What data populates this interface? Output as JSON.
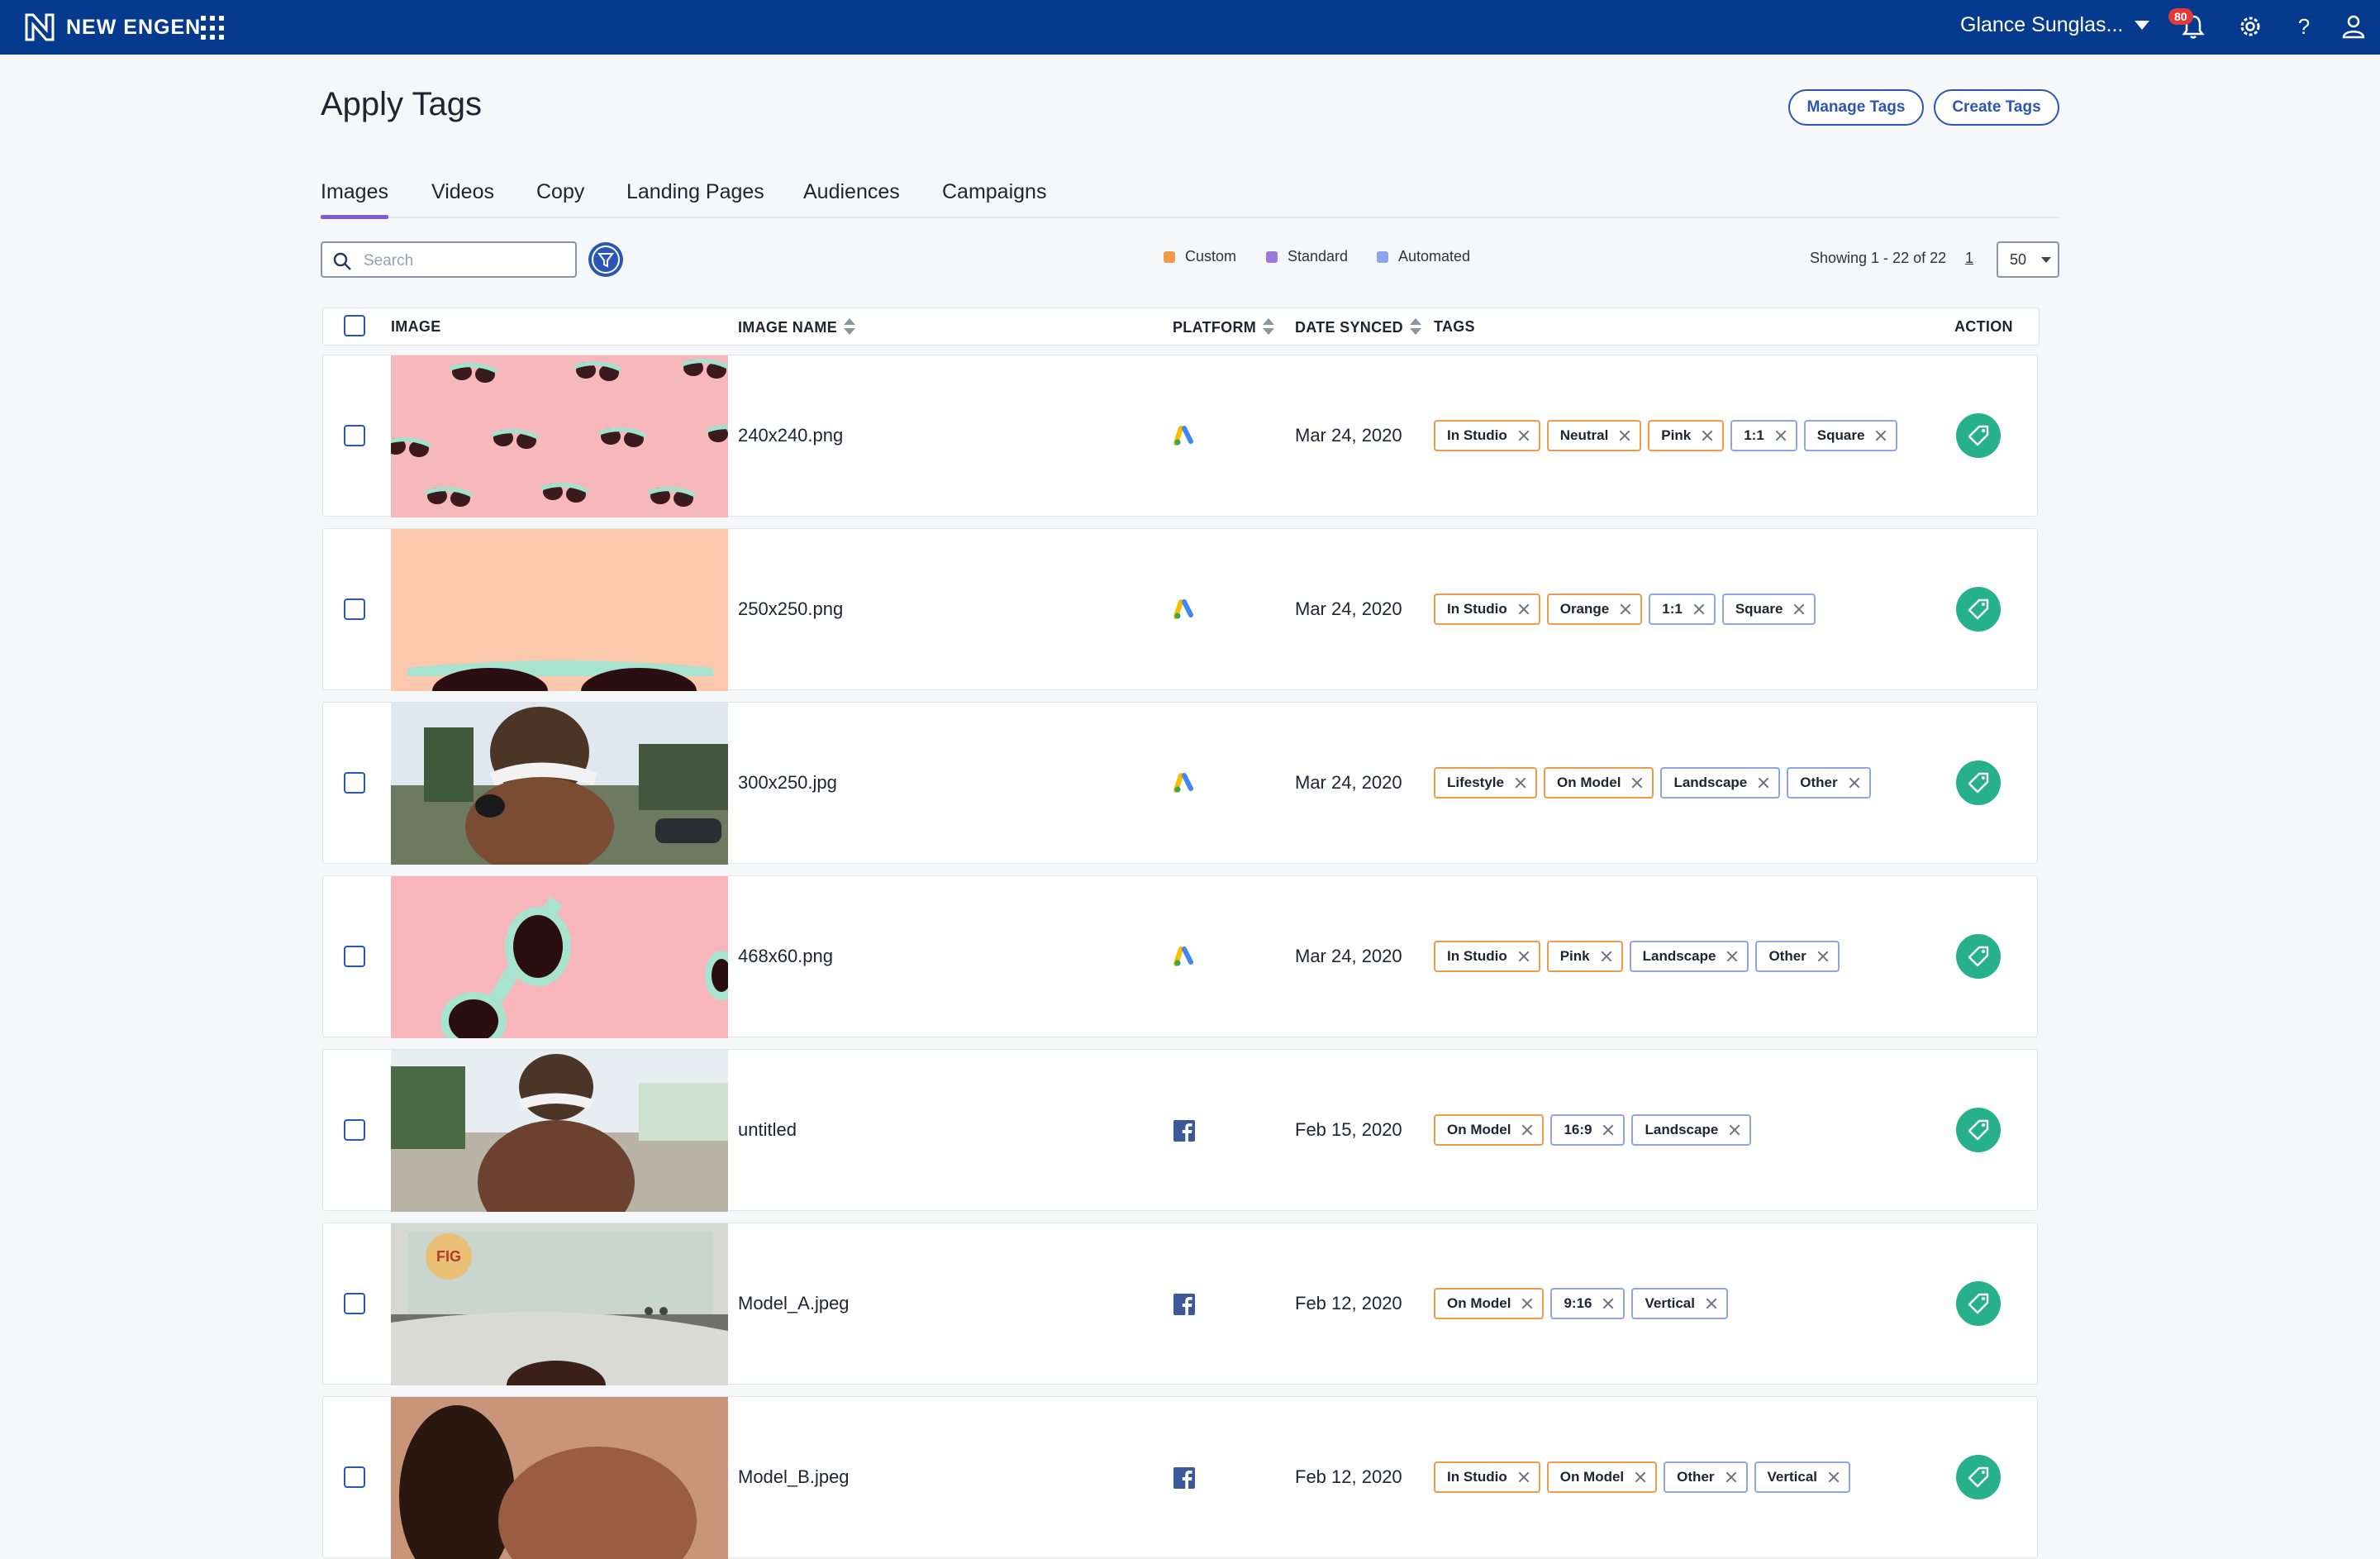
{
  "app": {
    "brand": "NEW ENGEN",
    "account": "Glance Sunglas...",
    "notifications": "80"
  },
  "header": {
    "title": "Apply Tags",
    "manage_tags": "Manage Tags",
    "create_tags": "Create Tags"
  },
  "tabs": [
    "Images",
    "Videos",
    "Copy",
    "Landing Pages",
    "Audiences",
    "Campaigns"
  ],
  "active_tab": "Images",
  "search": {
    "placeholder": "Search",
    "value": ""
  },
  "legend": [
    {
      "label": "Custom",
      "color": "#f29a4b"
    },
    {
      "label": "Standard",
      "color": "#9c7ad9"
    },
    {
      "label": "Automated",
      "color": "#8fa6e6"
    }
  ],
  "pagination": {
    "showing": "Showing 1 - 22 of 22",
    "page": "1",
    "per_page": "50"
  },
  "table": {
    "columns": {
      "image": "IMAGE",
      "image_name": "IMAGE NAME",
      "platform": "PLATFORM",
      "date_synced": "DATE SYNCED",
      "tags": "TAGS",
      "action": "ACTION"
    },
    "rows": [
      {
        "name": "240x240.png",
        "platform": "google-ads",
        "date": "Mar 24, 2020",
        "thumb": "pink-pattern",
        "tags": [
          {
            "label": "In Studio",
            "type": "custom"
          },
          {
            "label": "Neutral",
            "type": "custom"
          },
          {
            "label": "Pink",
            "type": "custom"
          },
          {
            "label": "1:1",
            "type": "automated"
          },
          {
            "label": "Square",
            "type": "automated"
          }
        ]
      },
      {
        "name": "250x250.png",
        "platform": "google-ads",
        "date": "Mar 24, 2020",
        "thumb": "peach-glasses",
        "tags": [
          {
            "label": "In Studio",
            "type": "custom"
          },
          {
            "label": "Orange",
            "type": "custom"
          },
          {
            "label": "1:1",
            "type": "automated"
          },
          {
            "label": "Square",
            "type": "automated"
          }
        ]
      },
      {
        "name": "300x250.jpg",
        "platform": "google-ads",
        "date": "Mar 24, 2020",
        "thumb": "model-photo",
        "tags": [
          {
            "label": "Lifestyle",
            "type": "custom"
          },
          {
            "label": "On Model",
            "type": "custom"
          },
          {
            "label": "Landscape",
            "type": "automated"
          },
          {
            "label": "Other",
            "type": "automated"
          }
        ]
      },
      {
        "name": "468x60.png",
        "platform": "google-ads",
        "date": "Mar 24, 2020",
        "thumb": "pink-glasses",
        "tags": [
          {
            "label": "In Studio",
            "type": "custom"
          },
          {
            "label": "Pink",
            "type": "custom"
          },
          {
            "label": "Landscape",
            "type": "automated"
          },
          {
            "label": "Other",
            "type": "automated"
          }
        ]
      },
      {
        "name": "untitled",
        "platform": "facebook",
        "date": "Feb 15, 2020",
        "thumb": "model-street",
        "tags": [
          {
            "label": "On Model",
            "type": "custom"
          },
          {
            "label": "16:9",
            "type": "automated"
          },
          {
            "label": "Landscape",
            "type": "automated"
          }
        ]
      },
      {
        "name": "Model_A.jpeg",
        "platform": "facebook",
        "date": "Feb 12, 2020",
        "thumb": "car-window",
        "tags": [
          {
            "label": "On Model",
            "type": "custom"
          },
          {
            "label": "9:16",
            "type": "automated"
          },
          {
            "label": "Vertical",
            "type": "automated"
          }
        ]
      },
      {
        "name": "Model_B.jpeg",
        "platform": "facebook",
        "date": "Feb 12, 2020",
        "thumb": "model-closeup",
        "tags": [
          {
            "label": "In Studio",
            "type": "custom"
          },
          {
            "label": "On Model",
            "type": "custom"
          },
          {
            "label": "Other",
            "type": "automated"
          },
          {
            "label": "Vertical",
            "type": "automated"
          }
        ]
      }
    ]
  }
}
